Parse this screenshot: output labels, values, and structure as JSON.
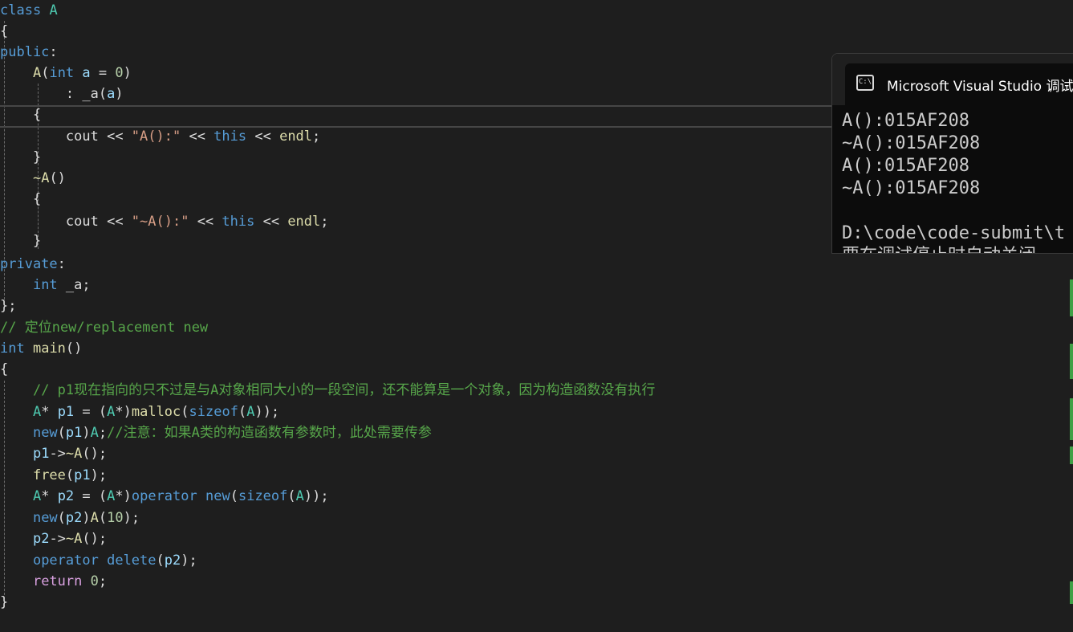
{
  "console": {
    "title": "Microsoft Visual Studio 调试控制台",
    "output": [
      "A():015AF208",
      "~A():015AF208",
      "A():015AF208",
      "~A():015AF208",
      "",
      "D:\\code\\code-submit\\t",
      "要在调试停止时自动关闭"
    ]
  },
  "code": {
    "class_kw": "class",
    "class_name": "A",
    "public_kw": "public",
    "private_kw": "private",
    "ctor_name": "A",
    "int_kw": "int",
    "param_a": "a",
    "zero": "0",
    "init_member": "_a",
    "init_arg": "a",
    "cout": "cout",
    "endl": "endl",
    "this_kw": "this",
    "str_ctor": "\"A():\"",
    "str_dtor": "\"~A():\"",
    "dtor_name": "~A",
    "member_name": "_a",
    "comment_placement": "// 定位new/replacement new",
    "main_name": "main",
    "comment_p1": "// p1现在指向的只不过是与A对象相同大小的一段空间，还不能算是一个对象，因为构造函数没有执行",
    "p1": "p1",
    "p2": "p2",
    "malloc_fn": "malloc",
    "sizeof_kw": "sizeof",
    "new_kw": "new",
    "comment_note": "//注意：如果A类的构造函数有参数时，此处需要传参",
    "free_fn": "free",
    "operator_kw": "operator",
    "delete_kw": "delete",
    "ten": "10",
    "return_kw": "return"
  }
}
